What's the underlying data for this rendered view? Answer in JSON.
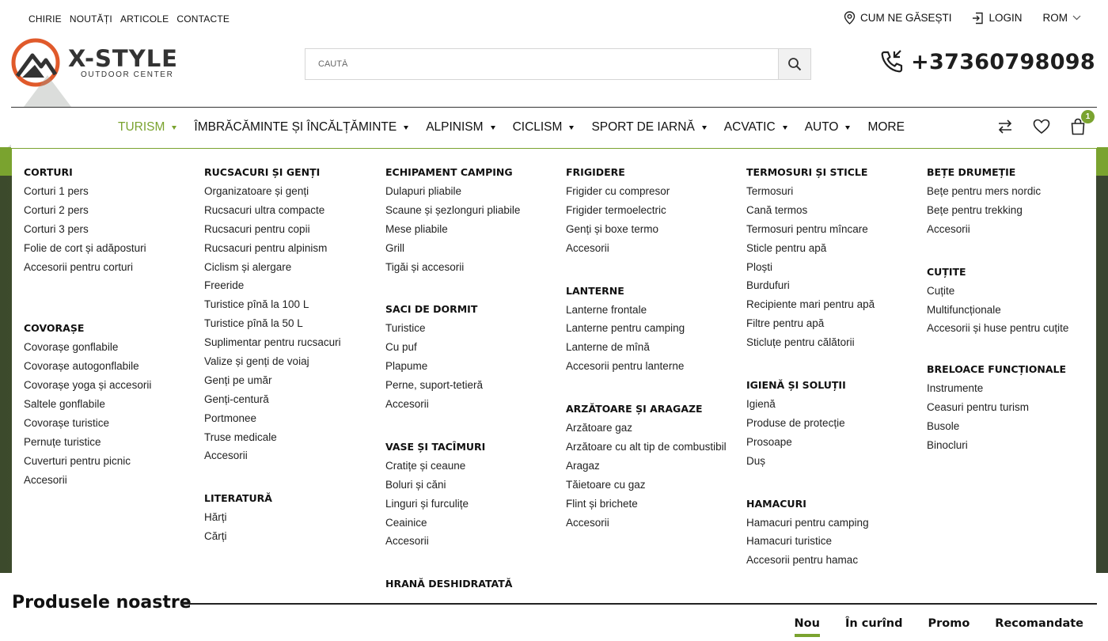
{
  "topbar": {
    "links": [
      "CHIRIE",
      "NOUTĂȚI",
      "ARTICOLE",
      "CONTACTE"
    ],
    "location_label": "CUM NE GĂSEȘTI",
    "login_label": "LOGIN",
    "language": "ROM"
  },
  "header": {
    "logo_title": "X-STYLE",
    "logo_subtitle": "OUTDOOR CENTER",
    "search_placeholder": "CAUTĂ",
    "phone": "+37360798098"
  },
  "nav": {
    "items": [
      {
        "label": "TURISM",
        "active": true,
        "dropdown": true
      },
      {
        "label": "ÎMBRĂCĂMINTE ȘI ÎNCĂLȚĂMINTE",
        "dropdown": true
      },
      {
        "label": "ALPINISM",
        "dropdown": true
      },
      {
        "label": "CICLISM",
        "dropdown": true
      },
      {
        "label": "SPORT DE IARNĂ",
        "dropdown": true
      },
      {
        "label": "ACVATIC",
        "dropdown": true
      },
      {
        "label": "AUTO",
        "dropdown": true
      },
      {
        "label": "MORE",
        "dropdown": false
      }
    ],
    "cart_count": "1",
    "accent": "#7aa32f"
  },
  "mega": {
    "columns": [
      [
        {
          "title": "CORTURI",
          "items": [
            "Corturi 1 pers",
            "Corturi 2 pers",
            "Corturi 3 pers",
            "Folie de cort și adăposturi",
            "Accesorii pentru corturi"
          ]
        },
        {
          "title": "COVORAȘE",
          "items": [
            "Covorașe gonflabile",
            "Covorașe autogonflabile",
            "Covorașe yoga și accesorii",
            "Saltele gonflabile",
            "Covorașe turistice",
            "Pernuțe turistice",
            "Cuverturi pentru picnic",
            "Accesorii"
          ]
        }
      ],
      [
        {
          "title": "RUCSACURI ȘI GENȚI",
          "items": [
            "Organizatoare și genți",
            "Rucsacuri ultra compacte",
            "Rucsacuri pentru copii",
            "Rucsacuri pentru alpinism",
            "Ciclism și alergare",
            "Freeride",
            "Turistice pînă la 100 L",
            "Turistice pînă la 50 L",
            "Suplimentar pentru rucsacuri",
            "Valize și genți de voiaj",
            "Genți pe umăr",
            "Genți-centură",
            "Portmonee",
            "Truse medicale",
            "Accesorii"
          ]
        },
        {
          "title": "LITERATURĂ",
          "items": [
            "Hărți",
            "Cărți"
          ]
        }
      ],
      [
        {
          "title": "ECHIPAMENT CAMPING",
          "items": [
            "Dulapuri pliabile",
            "Scaune și șezlonguri pliabile",
            "Mese pliabile",
            "Grill",
            "Tigăi și accesorii"
          ]
        },
        {
          "title": "SACI DE DORMIT",
          "items": [
            "Turistice",
            "Cu puf",
            "Plapume",
            "Perne, suport-tetieră",
            "Accesorii"
          ]
        },
        {
          "title": "VASE ȘI TACÎMURI",
          "items": [
            "Cratițe și ceaune",
            "Boluri și căni",
            "Linguri și furculițe",
            "Ceainice",
            "Accesorii"
          ]
        },
        {
          "title": "HRANĂ DESHIDRATATĂ",
          "items": []
        }
      ],
      [
        {
          "title": "FRIGIDERE",
          "items": [
            "Frigider cu compresor",
            "Frigider termoelectric",
            "Genți și boxe termo",
            "Accesorii"
          ]
        },
        {
          "title": "LANTERNE",
          "items": [
            "Lanterne frontale",
            "Lanterne pentru camping",
            "Lanterne de mînă",
            "Accesorii pentru lanterne"
          ]
        },
        {
          "title": "ARZĂTOARE ȘI ARAGAZE",
          "items": [
            "Arzătoare gaz",
            "Arzătoare cu alt tip de combustibil",
            "Aragaz",
            "Tăietoare cu gaz",
            "Flint și brichete",
            "Accesorii"
          ]
        }
      ],
      [
        {
          "title": "TERMOSURI ȘI STICLE",
          "items": [
            "Termosuri",
            "Cană termos",
            "Termosuri pentru mîncare",
            "Sticle pentru apă",
            "Ploști",
            "Burdufuri",
            "Recipiente mari pentru apă",
            "Filtre pentru apă",
            "Sticluțe pentru călătorii"
          ]
        },
        {
          "title": "IGIENĂ ȘI SOLUȚII",
          "items": [
            "Igienă",
            "Produse de protecție",
            "Prosoape",
            "Duș"
          ]
        },
        {
          "title": "HAMACURI",
          "items": [
            "Hamacuri pentru camping",
            "Hamacuri turistice",
            "Accesorii pentru hamac"
          ]
        }
      ],
      [
        {
          "title": "BEȚE DRUMEȚIE",
          "items": [
            "Bețe pentru mers nordic",
            "Bețe pentru trekking",
            "Accesorii"
          ]
        },
        {
          "title": "CUȚITE",
          "items": [
            "Cuțite",
            "Multifuncționale",
            "Accesorii și huse pentru cuțite"
          ]
        },
        {
          "title": "BRELOACE FUNCȚIONALE",
          "items": [
            "Instrumente",
            "Ceasuri pentru turism",
            "Busole",
            "Binocluri"
          ]
        }
      ]
    ]
  },
  "products": {
    "title": "Produsele noastre",
    "tabs": [
      "Nou",
      "În curînd",
      "Promo",
      "Recomandate"
    ],
    "active_tab": "Nou"
  }
}
